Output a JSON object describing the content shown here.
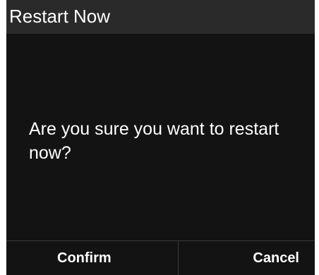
{
  "dialog": {
    "title": "Restart Now",
    "message": "Are you sure you want to restart now?",
    "confirm_label": "Confirm",
    "cancel_label": "Cancel"
  },
  "colors": {
    "background": "#131313",
    "header": "#2a2a2a",
    "divider": "#3a3a3a",
    "text": "#ffffff"
  }
}
